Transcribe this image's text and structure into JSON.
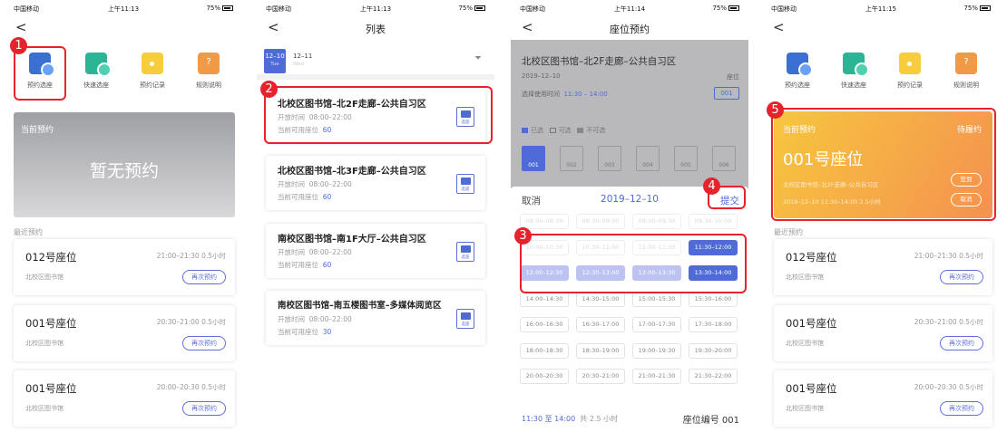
{
  "status": {
    "carrier": "中国移动",
    "battery": "75%",
    "times": [
      "上午11:13",
      "上午11:13",
      "上午11:14",
      "上午11:15"
    ]
  },
  "nav": {
    "back": "<",
    "list_title": "列表",
    "reserve_title": "座位预约"
  },
  "quick": [
    "预约选座",
    "快速选座",
    "预约记录",
    "规则说明"
  ],
  "current": {
    "header": "当前预约",
    "empty": "暂无预约"
  },
  "recent": {
    "header": "最近预约",
    "again_label": "再次预约",
    "items": [
      {
        "seat": "012号座位",
        "time": "21:00–21:30  0.5小时",
        "lib": "北校区图书馆"
      },
      {
        "seat": "001号座位",
        "time": "20:30–21:00  0.5小时",
        "lib": "北校区图书馆"
      },
      {
        "seat": "001号座位",
        "time": "20:00–20:30  0.5小时",
        "lib": "北校区图书馆"
      }
    ]
  },
  "dates": [
    {
      "date": "12–10",
      "day": "Tue"
    },
    {
      "date": "12–11",
      "day": "Wed"
    }
  ],
  "list": {
    "open_prefix": "开放时间",
    "avail_prefix": "当前可用座位",
    "select_label": "选座",
    "items": [
      {
        "title": "北校区图书馆–北2F走廊–公共自习区",
        "open": "08:00–22:00",
        "avail": "60"
      },
      {
        "title": "北校区图书馆–北3F走廊–公共自习区",
        "open": "08:00–22:00",
        "avail": "60"
      },
      {
        "title": "南校区图书馆–南1F大厅–公共自习区",
        "open": "08:00–22:00",
        "avail": "60"
      },
      {
        "title": "南校区图书馆–南五楼图书室–多媒体阅览区",
        "open": "08:00–22:00",
        "avail": "30"
      }
    ]
  },
  "reserve": {
    "title": "北校区图书馆–北2F走廊–公共自习区",
    "date": "2019–12–10",
    "floor": "座位",
    "use_label": "选择使用时间",
    "use_time": "11:30 – 14:00",
    "seat_no": "001",
    "legend": [
      "已选",
      "可选",
      "不可选"
    ],
    "seats": [
      "001",
      "002",
      "003",
      "004",
      "005",
      "006"
    ],
    "popup": {
      "cancel": "取消",
      "date": "2019–12–10",
      "submit": "提交",
      "slots": [
        {
          "label": "08:00–08:30",
          "state": "dis"
        },
        {
          "label": "08:30–09:00",
          "state": "dis"
        },
        {
          "label": "09:00–09:30",
          "state": "dis"
        },
        {
          "label": "09:30–10:00",
          "state": "dis"
        },
        {
          "label": "10:00–10:30",
          "state": "dis"
        },
        {
          "label": "10:30–11:00",
          "state": "dis"
        },
        {
          "label": "11:00–11:30",
          "state": "dis"
        },
        {
          "label": "11:30–12:00",
          "state": "on"
        },
        {
          "label": "12:00–12:30",
          "state": "lite"
        },
        {
          "label": "12:30–13:00",
          "state": "lite"
        },
        {
          "label": "13:00–13:30",
          "state": "lite"
        },
        {
          "label": "13:30–14:00",
          "state": "on"
        },
        {
          "label": "14:00–14:30",
          "state": "ok"
        },
        {
          "label": "14:30–15:00",
          "state": "ok"
        },
        {
          "label": "15:00–15:30",
          "state": "ok"
        },
        {
          "label": "15:30–16:00",
          "state": "ok"
        },
        {
          "label": "16:00–16:30",
          "state": "ok"
        },
        {
          "label": "16:30–17:00",
          "state": "ok"
        },
        {
          "label": "17:00–17:30",
          "state": "ok"
        },
        {
          "label": "17:30–18:00",
          "state": "ok"
        },
        {
          "label": "18:00–18:30",
          "state": "ok"
        },
        {
          "label": "18:30–19:00",
          "state": "ok"
        },
        {
          "label": "19:00–19:30",
          "state": "ok"
        },
        {
          "label": "19:30–20:00",
          "state": "ok"
        },
        {
          "label": "20:00–20:30",
          "state": "ok"
        },
        {
          "label": "20:30–21:00",
          "state": "ok"
        },
        {
          "label": "21:00–21:30",
          "state": "ok"
        },
        {
          "label": "21:30–22:00",
          "state": "ok"
        }
      ],
      "foot_time": "11:30 至 14:00",
      "foot_total": "共 2.5 小时",
      "foot_seat": "座位编号 001"
    }
  },
  "booked": {
    "header": "当前预约",
    "status": "待履约",
    "seat": "001号座位",
    "loc": "北校区图书馆–北2F走廊–公共自习区",
    "time": "2019–12–10  11:30–14:00  2.5小时",
    "sign_in": "签到",
    "cancel": "取消"
  },
  "steps": [
    "1",
    "2",
    "3",
    "4",
    "5"
  ],
  "colors": {
    "accent": "#4e6bd8",
    "highlight": "#e6232c",
    "orange": "#f49150"
  }
}
